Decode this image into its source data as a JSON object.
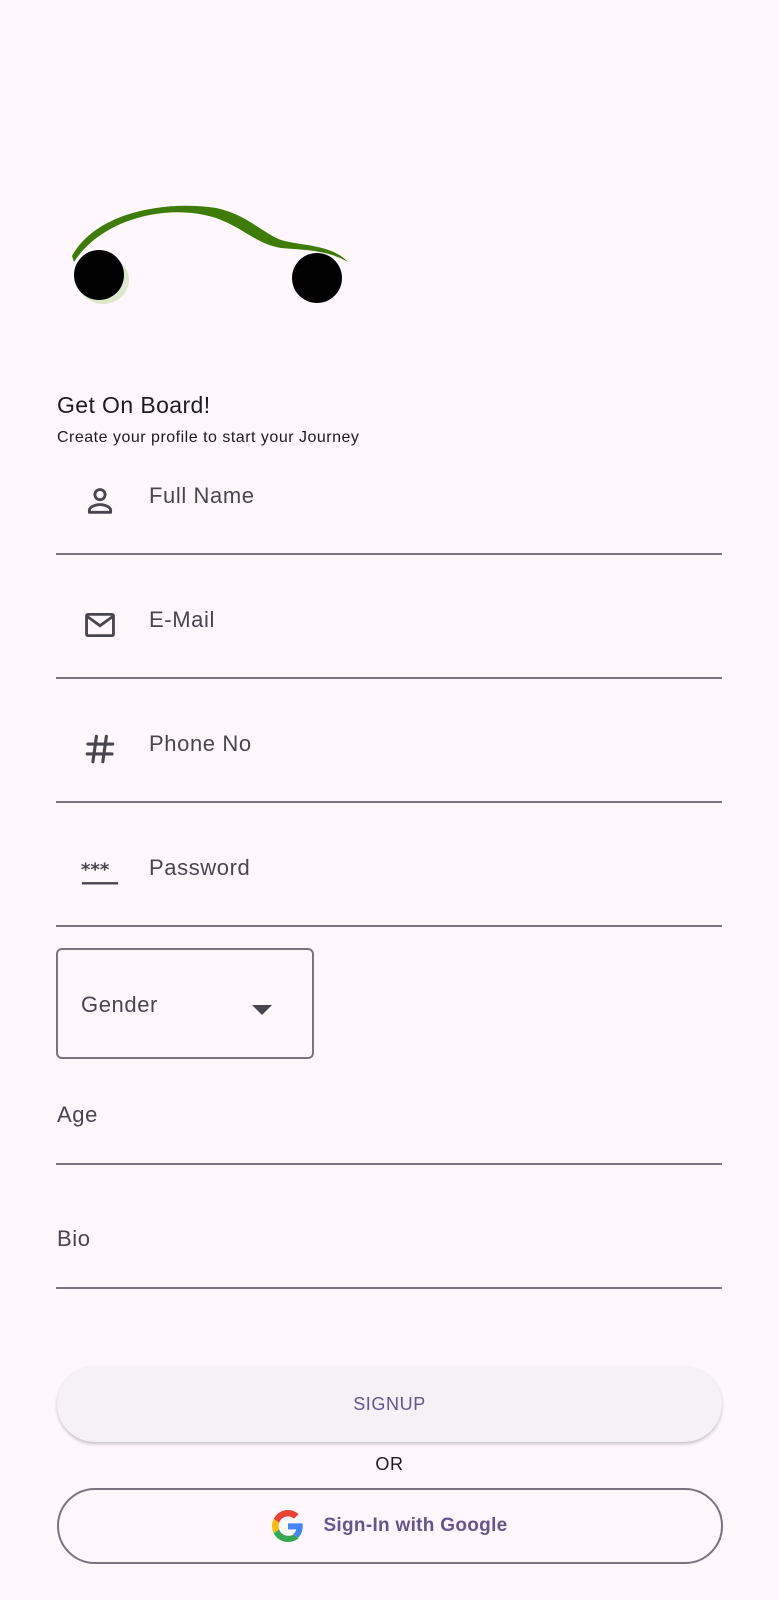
{
  "header": {
    "title": "Get On Board!",
    "subtitle": "Create your profile to start your Journey"
  },
  "form": {
    "full_name": {
      "label": "Full Name",
      "icon": "person-icon"
    },
    "email": {
      "label": "E-Mail",
      "icon": "mail-icon"
    },
    "phone": {
      "label": "Phone No",
      "icon": "hash-icon"
    },
    "password": {
      "label": "Password",
      "icon": "password-icon"
    },
    "gender": {
      "label": "Gender",
      "icon": "dropdown-arrow-icon"
    },
    "age": {
      "label": "Age"
    },
    "bio": {
      "label": "Bio"
    }
  },
  "actions": {
    "signup_label": "SIGNUP",
    "or_label": "OR",
    "google_label": "Sign-In with Google"
  },
  "colors": {
    "background": "#FEF7FC",
    "accent": "#65558F",
    "outline": "#79747E",
    "logo_green": "#3E7C07"
  }
}
